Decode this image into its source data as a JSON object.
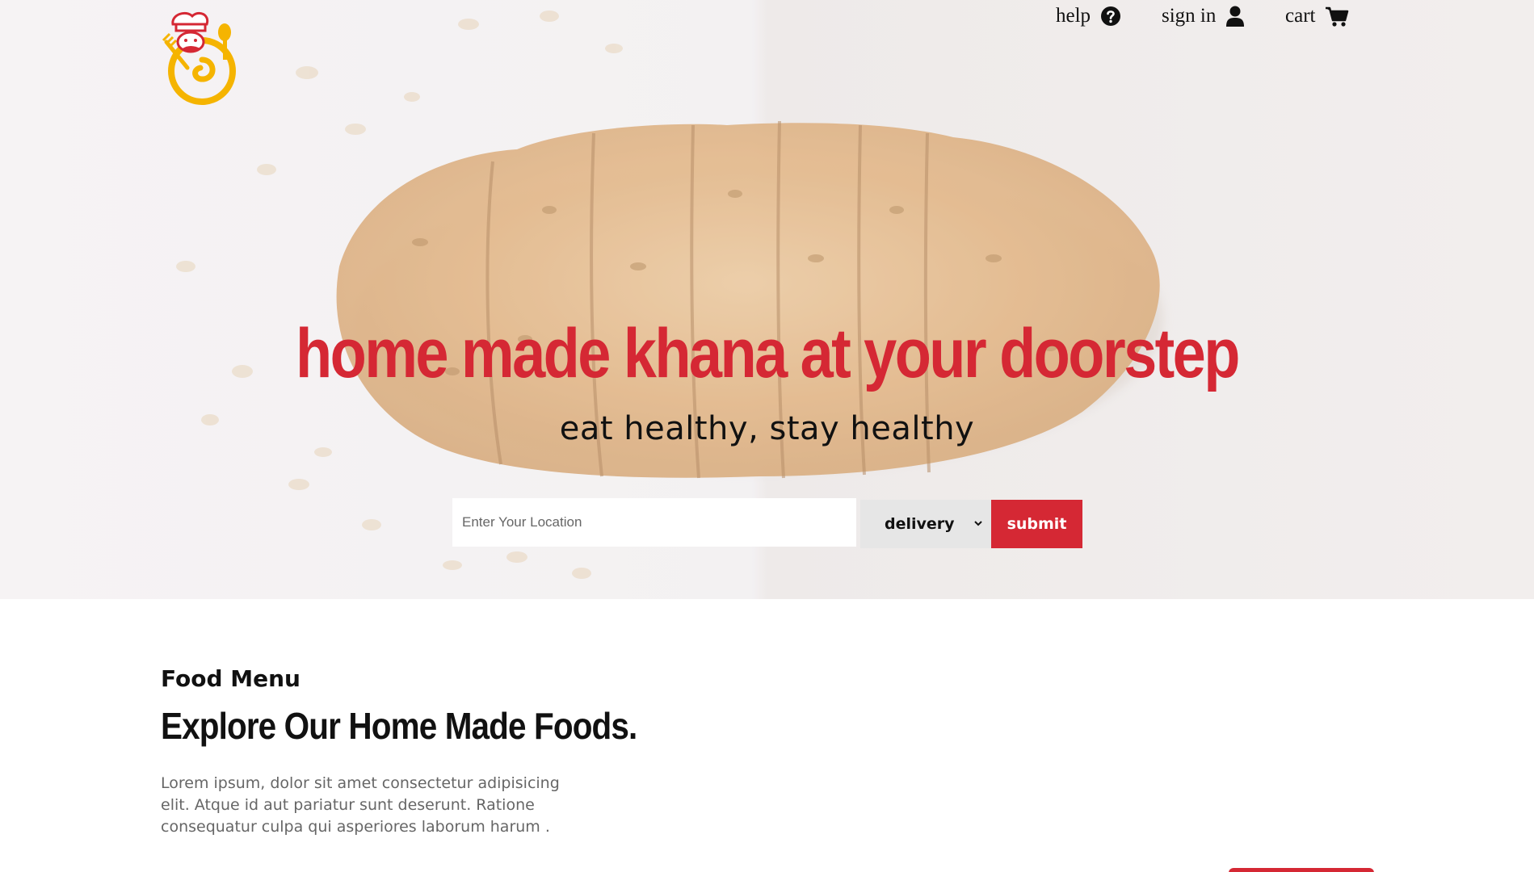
{
  "brand": {
    "logo_icon": "chef-logo-icon"
  },
  "nav": {
    "help_label": "help",
    "help_icon": "question-circle-icon",
    "signin_label": "sign in",
    "signin_icon": "user-icon",
    "cart_label": "cart",
    "cart_icon": "cart-icon"
  },
  "hero": {
    "headline": "home made khana at your doorstep",
    "subheadline": "eat healthy, stay healthy",
    "location_placeholder": "Enter Your Location",
    "mode_selected": "delivery",
    "submit_label": "submit"
  },
  "menu": {
    "kicker": "Food Menu",
    "title": "Explore Our Home Made Foods.",
    "description": "Lorem ipsum, dolor sit amet consectetur adipisicing elit. Atque id aut pariatur sunt deserunt. Ratione consequatur culpa qui asperiores laborum harum ."
  },
  "colors": {
    "accent": "#d52834",
    "logo_yellow": "#f5b400",
    "text": "#111111",
    "muted": "#666666"
  }
}
